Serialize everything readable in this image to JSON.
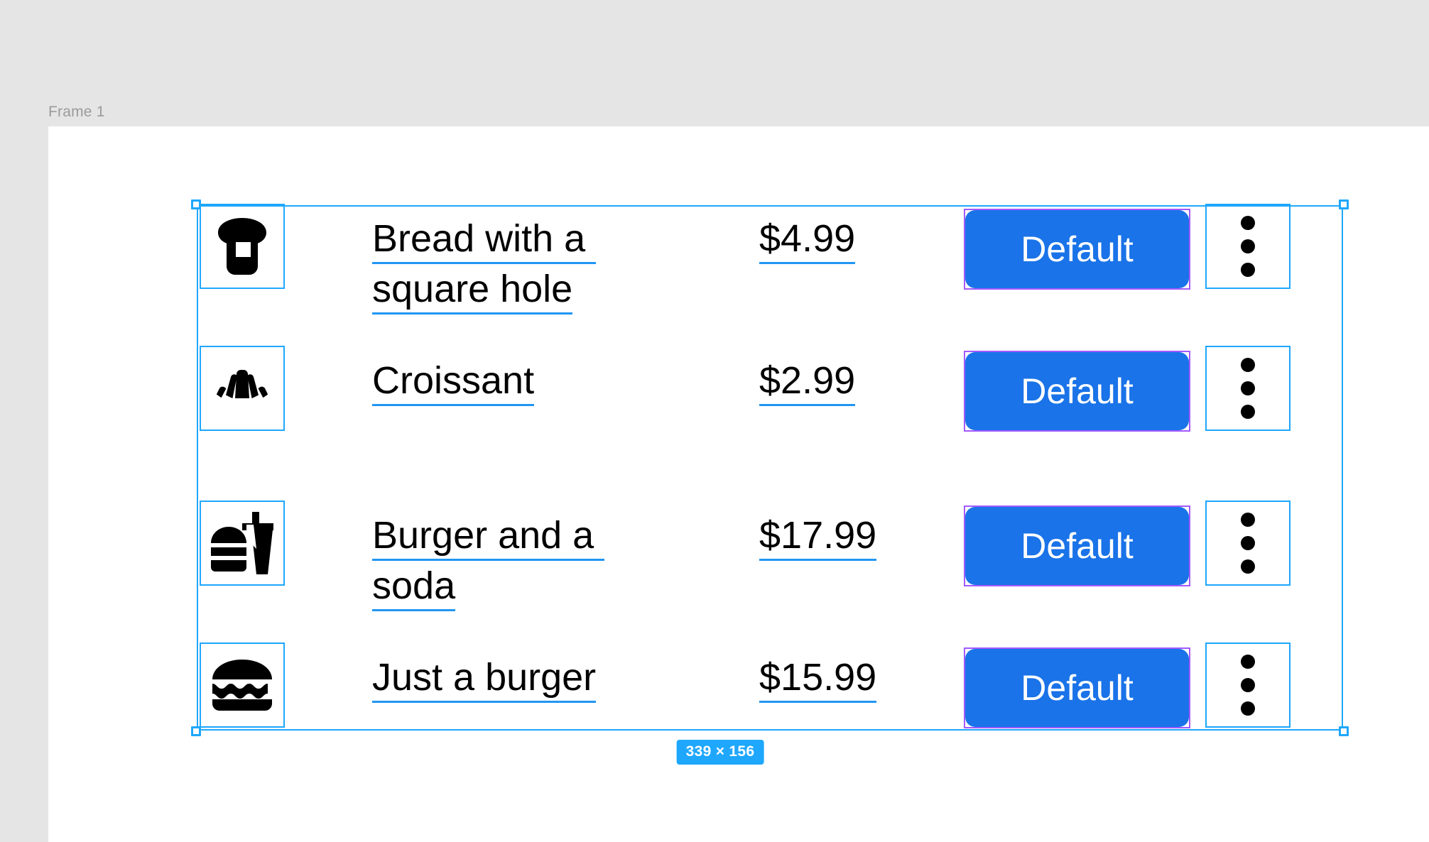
{
  "canvas": {
    "background": "#e5e5e5",
    "frame_background": "#ffffff",
    "frame_label": "Frame 1",
    "selection_color": "#1ea7fd",
    "instance_outline_color": "#a259ff",
    "dimension_badge": "339 × 156"
  },
  "theme": {
    "button_blue": "#1a73e8",
    "underline_blue": "#2196f3",
    "text_black": "#000000",
    "button_text": "#ffffff"
  },
  "list": {
    "rows": [
      {
        "icon": "bread-slice-icon",
        "label_lines": [
          "Bread with a ",
          "square hole"
        ],
        "price": "$4.99",
        "button_label": "Default",
        "menu_icon": "more-vertical-icon"
      },
      {
        "icon": "croissant-icon",
        "label_lines": [
          "Croissant"
        ],
        "price": "$2.99",
        "button_label": "Default",
        "menu_icon": "more-vertical-icon"
      },
      {
        "icon": "fast-food-icon",
        "label_lines": [
          "Burger and a ",
          "soda"
        ],
        "price": "$17.99",
        "button_label": "Default",
        "menu_icon": "more-vertical-icon"
      },
      {
        "icon": "hamburger-icon",
        "label_lines": [
          "Just a burger"
        ],
        "price": "$15.99",
        "button_label": "Default",
        "menu_icon": "more-vertical-icon"
      }
    ]
  }
}
